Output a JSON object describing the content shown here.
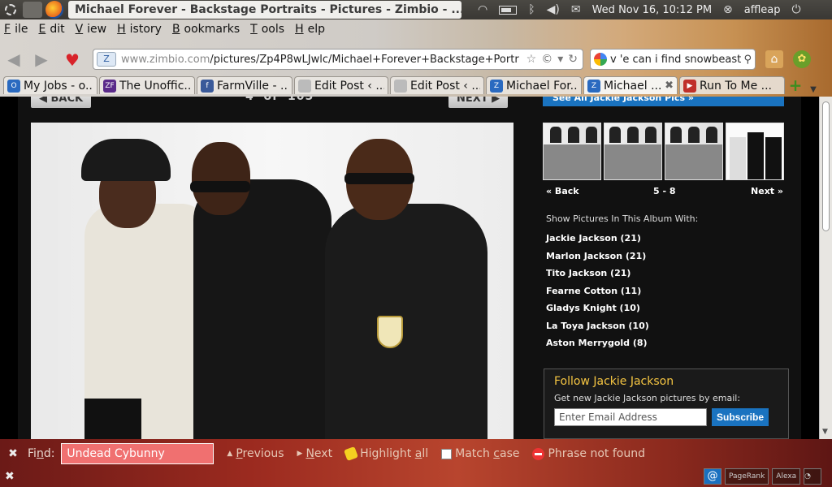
{
  "system": {
    "window_title": "Michael Forever - Backstage Portraits - Pictures - Zimbio - ...",
    "close_glyph": "✖",
    "clock": "Wed Nov 16, 10:12 PM",
    "user": "affleap",
    "icons": [
      "ubuntu-icon",
      "text-editor-icon",
      "firefox-icon",
      "wifi-icon",
      "battery-icon",
      "bluetooth-icon",
      "volume-icon",
      "mail-icon",
      "power-icon"
    ]
  },
  "menu": [
    {
      "u": "F",
      "rest": "ile"
    },
    {
      "u": "E",
      "rest": "dit"
    },
    {
      "u": "V",
      "rest": "iew"
    },
    {
      "u": "H",
      "rest": "istory"
    },
    {
      "u": "B",
      "rest": "ookmarks"
    },
    {
      "u": "T",
      "rest": "ools"
    },
    {
      "u": "H",
      "rest": "elp"
    }
  ],
  "nav": {
    "url_domain": "www.zimbio.com",
    "url_path": "/pictures/Zp4P8wLJwlc/Michael+Forever+Backstage+Portr",
    "search_value": "v 'e can i find snowbeast"
  },
  "tabs": [
    {
      "label": "My Jobs - o...",
      "fav_color": "#2a6ac0",
      "fav_glyph": "O"
    },
    {
      "label": "The Unoffic...",
      "fav_color": "#5a2a8a",
      "fav_glyph": "ZF"
    },
    {
      "label": "FarmVille - ...",
      "fav_color": "#3a5a9a",
      "fav_glyph": "f"
    },
    {
      "label": "Edit Post ‹ ...",
      "fav_color": "#bbbbbb",
      "fav_glyph": ""
    },
    {
      "label": "Edit Post ‹ ...",
      "fav_color": "#bbbbbb",
      "fav_glyph": ""
    },
    {
      "label": "Michael For...",
      "fav_color": "#2a6ac0",
      "fav_glyph": "Z"
    },
    {
      "label": "Michael ...",
      "fav_color": "#2a6ac0",
      "fav_glyph": "Z"
    },
    {
      "label": "Run To Me ...",
      "fav_color": "#c0302a",
      "fav_glyph": "▶"
    }
  ],
  "tab_close_glyph": "✖",
  "gallery": {
    "back_label": "◀ BACK",
    "next_label": "NEXT ▶",
    "position": "4",
    "of_label": "of",
    "total": "105",
    "see_all": "See All Jackie Jackson Pics »",
    "thumb_back": "« Back",
    "thumb_range": "5 - 8",
    "thumb_next": "Next »",
    "show_label": "Show Pictures In This Album With:",
    "album_people": [
      "Jackie Jackson (21)",
      "Marlon Jackson (21)",
      "Tito Jackson (21)",
      "Fearne Cotton (11)",
      "Gladys Knight (10)",
      "La Toya Jackson (10)",
      "Aston Merrygold (8)"
    ]
  },
  "follow": {
    "title": "Follow Jackie Jackson",
    "subtitle": "Get new Jackie Jackson pictures by email:",
    "email_placeholder": "Enter Email Address",
    "subscribe_label": "Subscribe"
  },
  "findbar": {
    "find_u": "n",
    "find_pre": "Fi",
    "find_post": "d:",
    "query": "Undead Cybunny",
    "previous_u": "P",
    "previous_rest": "revious",
    "next_u": "N",
    "next_rest": "ext",
    "highlight_pre": "Highlight ",
    "highlight_u": "a",
    "highlight_post": "ll",
    "match_pre": "Match ",
    "match_u": "c",
    "match_post": "ase",
    "status": "Phrase not found"
  },
  "statusbar": {
    "addon1": "PageRank",
    "addon2": "Alexa"
  }
}
